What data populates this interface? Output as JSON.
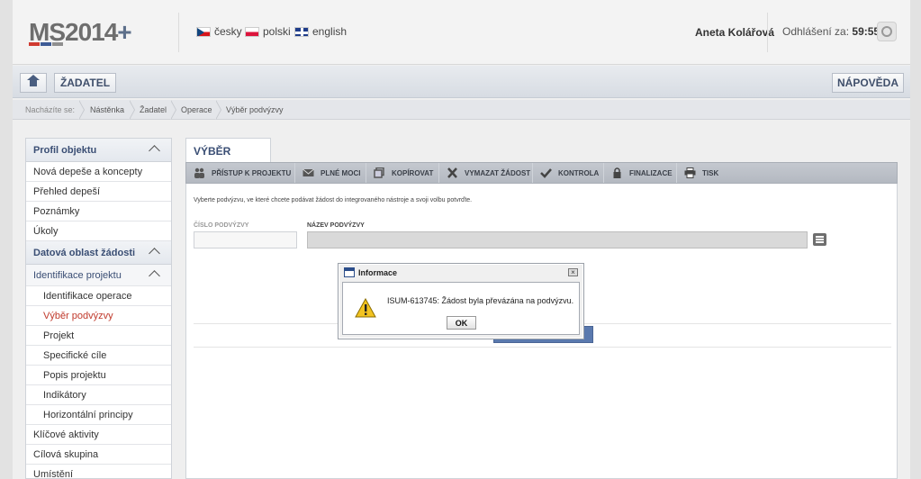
{
  "header": {
    "logo_main": "MS2014",
    "logo_plus": "+",
    "languages": [
      {
        "label": "česky",
        "flag": "flag-cz-icon"
      },
      {
        "label": "polski",
        "flag": "flag-pl-icon"
      },
      {
        "label": "english",
        "flag": "flag-en-icon"
      }
    ],
    "user_name": "Aneta Kolářová",
    "logout_label": "Odhlášení za:",
    "logout_time": "59:55"
  },
  "toolbar": {
    "zadatel_label": "ŽADATEL",
    "napoveda_label": "NÁPOVĚDA"
  },
  "breadcrumb": {
    "label": "Nacházíte se:",
    "items": [
      "Nástěnka",
      "Žadatel",
      "Operace",
      "Výběr podvýzvy"
    ]
  },
  "sidebar": {
    "items": [
      {
        "label": "Profil objektu"
      },
      {
        "label": "Nová depeše a koncepty"
      },
      {
        "label": "Přehled depeší"
      },
      {
        "label": "Poznámky"
      },
      {
        "label": "Úkoly"
      },
      {
        "label": "Datová oblast žádosti"
      },
      {
        "label": "Identifikace projektu"
      },
      {
        "label": "Identifikace operace"
      },
      {
        "label": "Výběr podvýzvy"
      },
      {
        "label": "Projekt"
      },
      {
        "label": "Specifické cíle"
      },
      {
        "label": "Popis projektu"
      },
      {
        "label": "Indikátory"
      },
      {
        "label": "Horizontální principy"
      },
      {
        "label": "Klíčové aktivity"
      },
      {
        "label": "Cílová skupina"
      },
      {
        "label": "Umístění"
      }
    ]
  },
  "main": {
    "tab_title": "VÝBĚR PODVÝZVY",
    "actions": [
      {
        "label": "PŘÍSTUP K PROJEKTU",
        "icon": "people-icon"
      },
      {
        "label": "PLNÉ MOCI",
        "icon": "envelope-icon"
      },
      {
        "label": "KOPÍROVAT",
        "icon": "copy-icon"
      },
      {
        "label": "VYMAZAT ŽÁDOST",
        "icon": "x-icon"
      },
      {
        "label": "KONTROLA",
        "icon": "check-icon"
      },
      {
        "label": "FINALIZACE",
        "icon": "lock-icon"
      },
      {
        "label": "TISK",
        "icon": "printer-icon"
      }
    ],
    "instruction": "Vyberte podvýzvu, ve které chcete podávat žádost do integrovaného nástroje a svoji volbu potvrďte.",
    "field_number_label": "ČÍSLO PODVÝZVY",
    "field_number_value": "",
    "field_name_label": "NÁZEV PODVÝZVY",
    "field_name_value": ""
  },
  "dialog": {
    "title": "Informace",
    "message": "ISUM-613745: Žádost byla převázána na podvýzvu.",
    "ok_label": "OK"
  },
  "colors": {
    "accent_blue": "#3a4e74",
    "active_red": "#c0392b",
    "logo_red": "#d03a30",
    "logo_blue": "#3d5b96"
  }
}
